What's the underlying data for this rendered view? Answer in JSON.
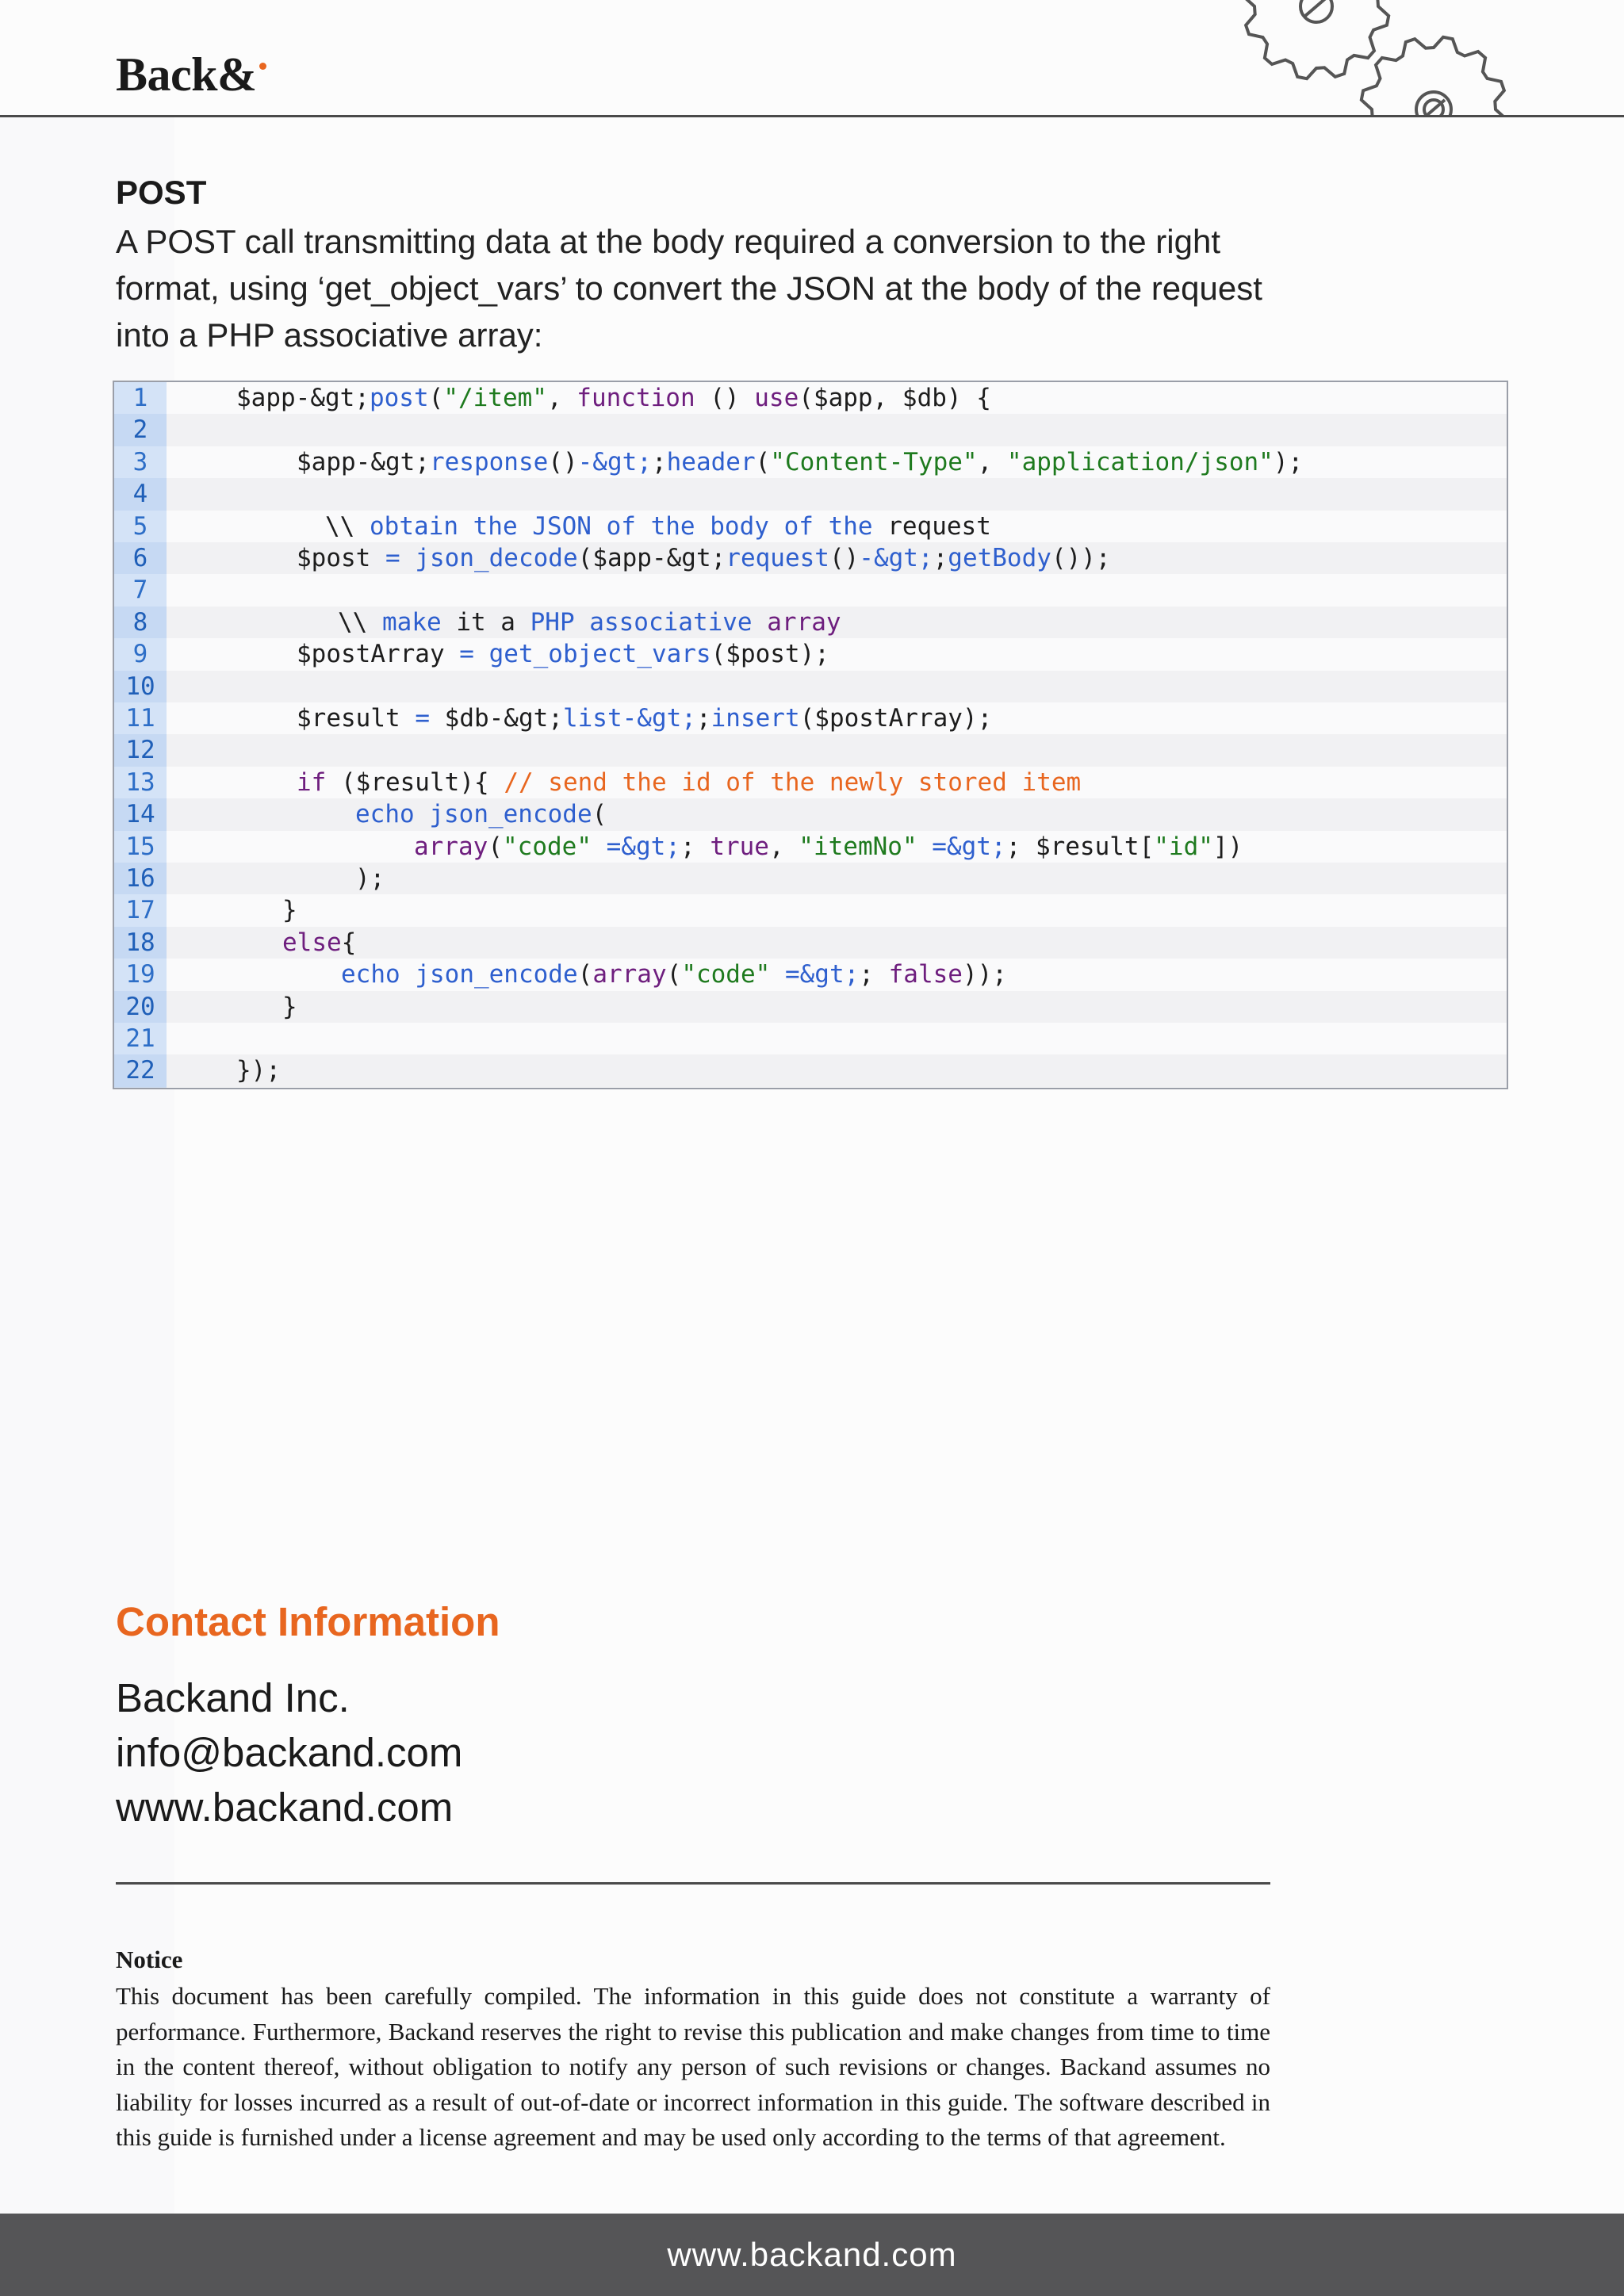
{
  "header": {
    "logo_text": "Back&",
    "brand_accent": "#e8661f",
    "decoration_icon": "gears-icon"
  },
  "post": {
    "heading": "POST",
    "body": "A POST call transmitting data at the body required a conversion to the right format, using ‘get_object_vars’ to convert the JSON at the body of the request into a PHP associative array:"
  },
  "code": {
    "lines": [
      {
        "n": "1",
        "indent": 0,
        "tokens": [
          [
            "$app-&gt;",
            "var"
          ],
          [
            "post",
            "fn"
          ],
          [
            "(",
            "plain"
          ],
          [
            "\"/item\"",
            "str"
          ],
          [
            ", ",
            "plain"
          ],
          [
            "function",
            "kw"
          ],
          [
            " () ",
            "plain"
          ],
          [
            "use",
            "kw"
          ],
          [
            "(",
            "plain"
          ],
          [
            "$app",
            "var"
          ],
          [
            ", ",
            "plain"
          ],
          [
            "$db",
            "var"
          ],
          [
            ") {",
            "plain"
          ]
        ]
      },
      {
        "n": "2",
        "indent": 0,
        "tokens": []
      },
      {
        "n": "3",
        "indent": 1,
        "tokens": [
          [
            "$app-&gt;",
            "var"
          ],
          [
            "response",
            "fn"
          ],
          [
            "()",
            "plain"
          ],
          [
            "-&gt;",
            "blue"
          ],
          [
            ";",
            "plain"
          ],
          [
            "header",
            "fn"
          ],
          [
            "(",
            "plain"
          ],
          [
            "\"Content-Type\"",
            "str"
          ],
          [
            ", ",
            "plain"
          ],
          [
            "\"application/json\"",
            "str"
          ],
          [
            ");",
            "plain"
          ]
        ]
      },
      {
        "n": "4",
        "indent": 0,
        "tokens": []
      },
      {
        "n": "5",
        "indent": 2,
        "tokens": [
          [
            "\\\\ ",
            "plain"
          ],
          [
            "obtain the JSON of the body of the",
            "blue"
          ],
          [
            " request",
            "plain"
          ]
        ]
      },
      {
        "n": "6",
        "indent": 1,
        "tokens": [
          [
            "$post",
            "var"
          ],
          [
            " = ",
            "blue"
          ],
          [
            "json_decode",
            "fn"
          ],
          [
            "(",
            "plain"
          ],
          [
            "$app-&gt;",
            "var"
          ],
          [
            "request",
            "fn"
          ],
          [
            "()",
            "plain"
          ],
          [
            "-&gt;",
            "blue"
          ],
          [
            ";",
            "plain"
          ],
          [
            "getBody",
            "fn"
          ],
          [
            "());",
            "plain"
          ]
        ]
      },
      {
        "n": "7",
        "indent": 0,
        "tokens": []
      },
      {
        "n": "8",
        "indent": 3,
        "tokens": [
          [
            "\\\\ ",
            "plain"
          ],
          [
            "make",
            "blue"
          ],
          [
            " it a ",
            "plain"
          ],
          [
            "PHP associative",
            "blue"
          ],
          [
            " array",
            "kw"
          ]
        ]
      },
      {
        "n": "9",
        "indent": 1,
        "tokens": [
          [
            "$postArray",
            "var"
          ],
          [
            " = ",
            "blue"
          ],
          [
            "get_object_vars",
            "fn"
          ],
          [
            "(",
            "plain"
          ],
          [
            "$post",
            "var"
          ],
          [
            ");",
            "plain"
          ]
        ]
      },
      {
        "n": "10",
        "indent": 0,
        "tokens": []
      },
      {
        "n": "11",
        "indent": 1,
        "tokens": [
          [
            "$result",
            "var"
          ],
          [
            " = ",
            "blue"
          ],
          [
            "$db-&gt;",
            "var"
          ],
          [
            "list-&gt;",
            "blue"
          ],
          [
            ";",
            "plain"
          ],
          [
            "insert",
            "fn"
          ],
          [
            "(",
            "plain"
          ],
          [
            "$postArray",
            "var"
          ],
          [
            ");",
            "plain"
          ]
        ]
      },
      {
        "n": "12",
        "indent": 0,
        "tokens": []
      },
      {
        "n": "13",
        "indent": 1,
        "tokens": [
          [
            "if",
            "kw"
          ],
          [
            " (",
            "plain"
          ],
          [
            "$result",
            "var"
          ],
          [
            "){ ",
            "plain"
          ],
          [
            "// send the id of the newly stored item",
            "com"
          ]
        ]
      },
      {
        "n": "14",
        "indent": 4,
        "tokens": [
          [
            "echo",
            "fn"
          ],
          [
            " ",
            "plain"
          ],
          [
            "json_encode",
            "fn"
          ],
          [
            "(",
            "plain"
          ]
        ]
      },
      {
        "n": "15",
        "indent": 5,
        "tokens": [
          [
            "array",
            "kw"
          ],
          [
            "(",
            "plain"
          ],
          [
            "\"code\"",
            "str"
          ],
          [
            " ",
            "plain"
          ],
          [
            "=&gt;",
            "blue"
          ],
          [
            "; ",
            "plain"
          ],
          [
            "true",
            "kw"
          ],
          [
            ", ",
            "plain"
          ],
          [
            "\"itemNo\"",
            "str"
          ],
          [
            " ",
            "plain"
          ],
          [
            "=&gt;",
            "blue"
          ],
          [
            "; ",
            "plain"
          ],
          [
            "$result",
            "var"
          ],
          [
            "[",
            "plain"
          ],
          [
            "\"id\"",
            "str"
          ],
          [
            "])",
            "plain"
          ]
        ]
      },
      {
        "n": "16",
        "indent": 4,
        "tokens": [
          [
            ");",
            "plain"
          ]
        ]
      },
      {
        "n": "17",
        "indent": 6,
        "tokens": [
          [
            "}",
            "plain"
          ]
        ]
      },
      {
        "n": "18",
        "indent": 6,
        "tokens": [
          [
            "else",
            "kw"
          ],
          [
            "{",
            "plain"
          ]
        ]
      },
      {
        "n": "19",
        "indent": 7,
        "tokens": [
          [
            "echo",
            "fn"
          ],
          [
            " ",
            "plain"
          ],
          [
            "json_encode",
            "fn"
          ],
          [
            "(",
            "plain"
          ],
          [
            "array",
            "kw"
          ],
          [
            "(",
            "plain"
          ],
          [
            "\"code\"",
            "str"
          ],
          [
            " ",
            "plain"
          ],
          [
            "=&gt;",
            "blue"
          ],
          [
            "; ",
            "plain"
          ],
          [
            "false",
            "kw"
          ],
          [
            "));",
            "plain"
          ]
        ]
      },
      {
        "n": "20",
        "indent": 6,
        "tokens": [
          [
            "}",
            "plain"
          ]
        ]
      },
      {
        "n": "21",
        "indent": 0,
        "tokens": []
      },
      {
        "n": "22",
        "indent": 0,
        "tokens": [
          [
            "});",
            "plain"
          ]
        ]
      }
    ]
  },
  "contact": {
    "title": "Contact Information",
    "company": "Backand Inc.",
    "email": "info@backand.com",
    "website": "www.backand.com"
  },
  "notice": {
    "title": "Notice",
    "body": "This document has been carefully compiled. The information in this guide does not constitute a warranty of performance. Furthermore, Backand reserves the right to revise this publication and make changes from time to time in the content thereof, without obligation to notify any person of such revisions or changes. Backand assumes no liability for losses incurred as a result of out-of-date or incorrect information in this guide. The software described in this guide is furnished under a license agreement and may be used only according to the terms of that agreement."
  },
  "footer": {
    "url": "www.backand.com"
  }
}
